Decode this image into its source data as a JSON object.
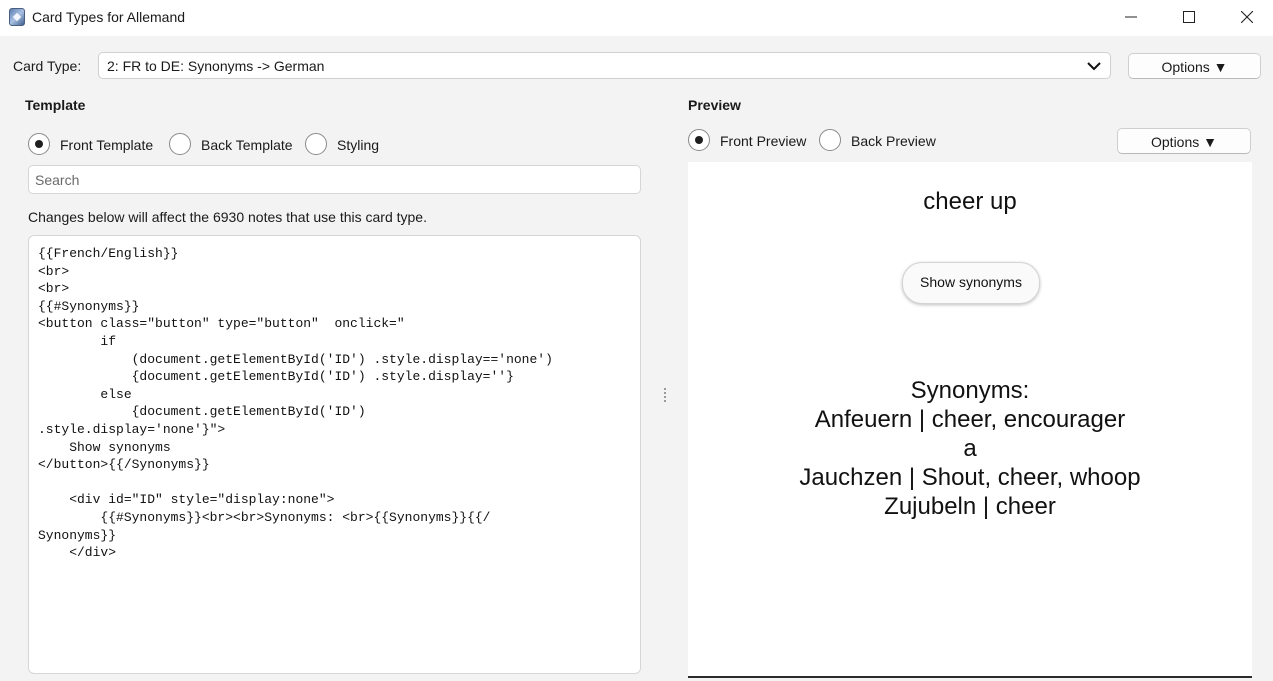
{
  "window": {
    "title": "Card Types for Allemand"
  },
  "card_type": {
    "label": "Card Type:",
    "selected": "2: FR to DE: Synonyms -> German",
    "options_label": "Options ▼"
  },
  "template": {
    "heading": "Template",
    "radios": [
      {
        "label": "Front Template",
        "checked": true
      },
      {
        "label": "Back Template",
        "checked": false
      },
      {
        "label": "Styling",
        "checked": false
      }
    ],
    "search_placeholder": "Search",
    "notice": "Changes below will affect the 6930 notes that use this card type.",
    "code": "{{French/English}}\n<br>\n<br>\n{{#Synonyms}}\n<button class=\"button\" type=\"button\"  onclick=\"\n        if\n            (document.getElementById('ID') .style.display=='none')\n            {document.getElementById('ID') .style.display=''}\n        else\n            {document.getElementById('ID')\n.style.display='none'}\">\n    Show synonyms\n</button>{{/Synonyms}}\n\n    <div id=\"ID\" style=\"display:none\">\n        {{#Synonyms}}<br><br>Synonyms: <br>{{Synonyms}}{{/\nSynonyms}}\n    </div>"
  },
  "preview": {
    "heading": "Preview",
    "radios": [
      {
        "label": "Front Preview",
        "checked": true
      },
      {
        "label": "Back Preview",
        "checked": false
      }
    ],
    "options_label": "Options ▼",
    "front_text": "cheer up",
    "show_button": "Show synonyms",
    "synonyms_lines": [
      "Synonyms:",
      "Anfeuern | cheer, encourager",
      "a",
      "Jauchzen | Shout, cheer, whoop",
      "Zujubeln | cheer"
    ]
  }
}
